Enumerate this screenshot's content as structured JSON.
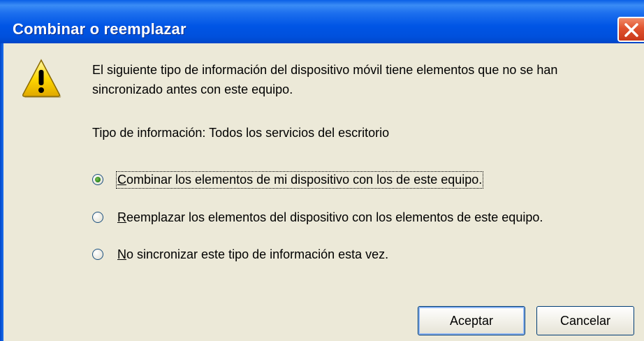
{
  "window": {
    "title": "Combinar o reemplazar"
  },
  "icons": {
    "warning": "warning-icon",
    "close": "close-icon"
  },
  "message": {
    "line1": "El siguiente tipo de información del dispositivo móvil tiene elementos que no se han",
    "line2": "sincronizado antes con este equipo.",
    "info_type": "Tipo de información: Todos los servicios del escritorio"
  },
  "options": [
    {
      "label_first": "C",
      "label_rest": "ombinar los elementos de mi dispositivo con los de este equipo.",
      "selected": true
    },
    {
      "label_first": "R",
      "label_rest": "eemplazar los elementos del dispositivo con los elementos de este equipo.",
      "selected": false
    },
    {
      "label_first": "N",
      "label_rest": "o sincronizar este tipo de información esta vez.",
      "selected": false
    }
  ],
  "buttons": {
    "ok": "Aceptar",
    "cancel": "Cancelar"
  },
  "colors": {
    "titlebar": "#0055e5",
    "background": "#ece9d8",
    "close": "#e0532f"
  }
}
